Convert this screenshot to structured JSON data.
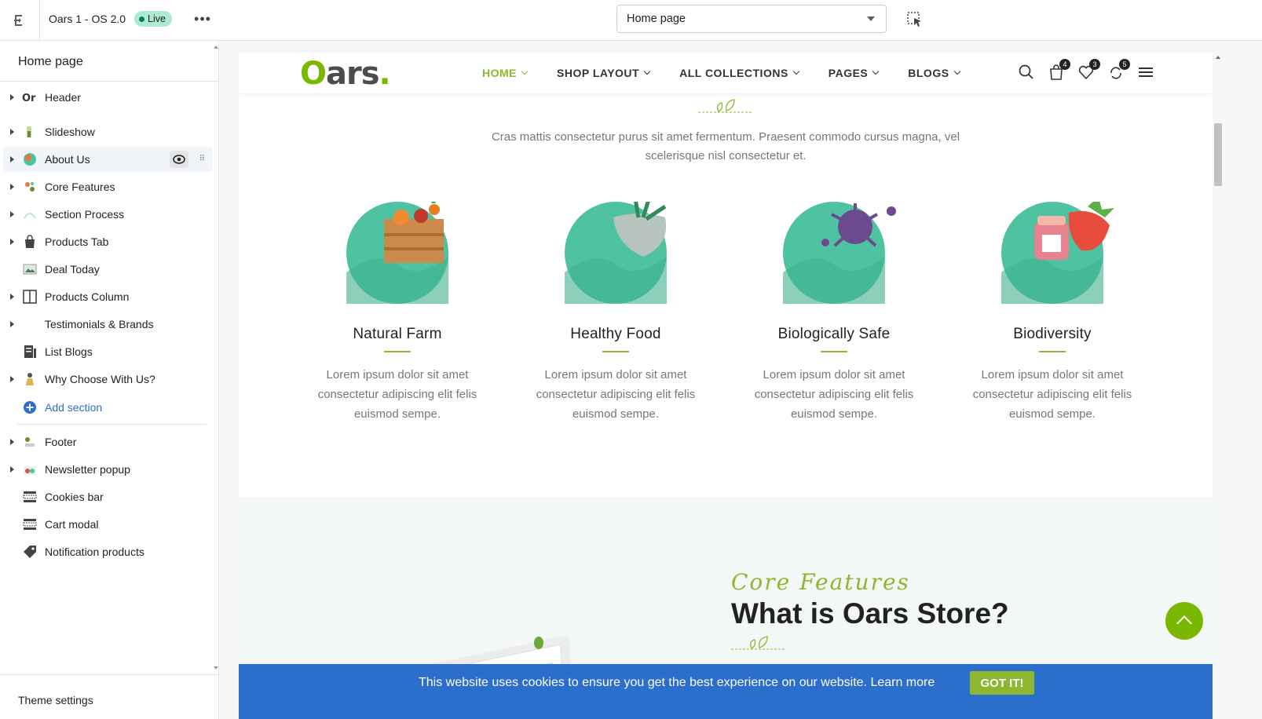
{
  "topbar": {
    "store_name": "Oars 1 - OS 2.0",
    "status_badge": "Live",
    "page_select": "Home page"
  },
  "sidebar": {
    "title": "Home page",
    "items": [
      {
        "label": "Header"
      },
      {
        "label": "Slideshow"
      },
      {
        "label": "About Us"
      },
      {
        "label": "Core Features"
      },
      {
        "label": "Section Process"
      },
      {
        "label": "Products Tab"
      },
      {
        "label": "Deal Today"
      },
      {
        "label": "Products Column"
      },
      {
        "label": "Testimonials & Brands"
      },
      {
        "label": "List Blogs"
      },
      {
        "label": "Why Choose With Us?"
      }
    ],
    "add_section": "Add section",
    "footer_items": [
      {
        "label": "Footer"
      },
      {
        "label": "Newsletter popup"
      },
      {
        "label": "Cookies bar"
      },
      {
        "label": "Cart modal"
      },
      {
        "label": "Notification products"
      }
    ],
    "theme_settings": "Theme settings"
  },
  "site": {
    "logo": {
      "o": "O",
      "rest": "ars",
      "dot": "."
    },
    "nav": [
      {
        "label": "HOME"
      },
      {
        "label": "SHOP LAYOUT"
      },
      {
        "label": "ALL COLLECTIONS"
      },
      {
        "label": "PAGES"
      },
      {
        "label": "BLOGS"
      }
    ],
    "badges": {
      "cart": "4",
      "wishlist": "3",
      "compare": "5"
    },
    "intro": "Cras mattis consectetur purus sit amet fermentum. Praesent commodo cursus magna, vel scelerisque nisl consectetur et.",
    "features": [
      {
        "title": "Natural Farm",
        "text": "Lorem ipsum dolor sit amet consectetur adipiscing elit felis euismod sempe."
      },
      {
        "title": "Healthy Food",
        "text": "Lorem ipsum dolor sit amet consectetur adipiscing elit felis euismod sempe."
      },
      {
        "title": "Biologically Safe",
        "text": "Lorem ipsum dolor sit amet consectetur adipiscing elit felis euismod sempe."
      },
      {
        "title": "Biodiversity",
        "text": "Lorem ipsum dolor sit amet consectetur adipiscing elit felis euismod sempe."
      }
    ],
    "core": {
      "script": "Core Features",
      "title": "What is Oars Store?"
    },
    "cookie": {
      "text": "This website uses cookies to ensure you get the best experience on our website. Learn more",
      "button": "GOT IT!"
    }
  },
  "colors": {
    "accent": "#8db72e",
    "teal": "#4fc3a1",
    "cookie_bg": "#2c6ecb",
    "link": "#2c6ecb"
  }
}
